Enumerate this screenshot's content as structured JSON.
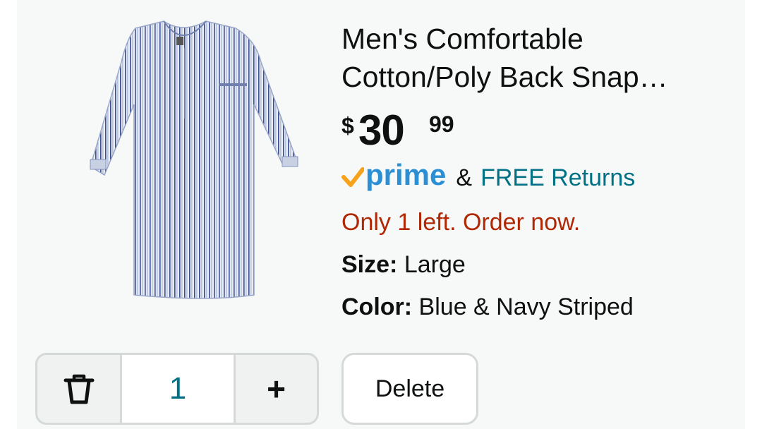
{
  "product": {
    "title": "Men's Comfortable Cotton/Poly Back Snap…",
    "image_alt_icon": "striped-nightshirt-image",
    "price": {
      "symbol": "$",
      "whole": "30",
      "fraction": "99"
    },
    "prime_label": "prime",
    "ampersand": "&",
    "returns_label": "FREE Returns",
    "stock_message": "Only 1 left. Order now.",
    "size_label": "Size:",
    "size_value": "Large",
    "color_label": "Color:",
    "color_value": "Blue & Navy Striped"
  },
  "actions": {
    "trash_icon": "trash-icon",
    "quantity": "1",
    "increment_label": "+",
    "delete_label": "Delete"
  },
  "colors": {
    "link": "#007185",
    "stock_warning": "#b12704",
    "prime_blue": "#2b8fd6",
    "prime_check": "#f7a21b",
    "card_background": "#f7f8f8",
    "border": "#d5d9d9"
  }
}
